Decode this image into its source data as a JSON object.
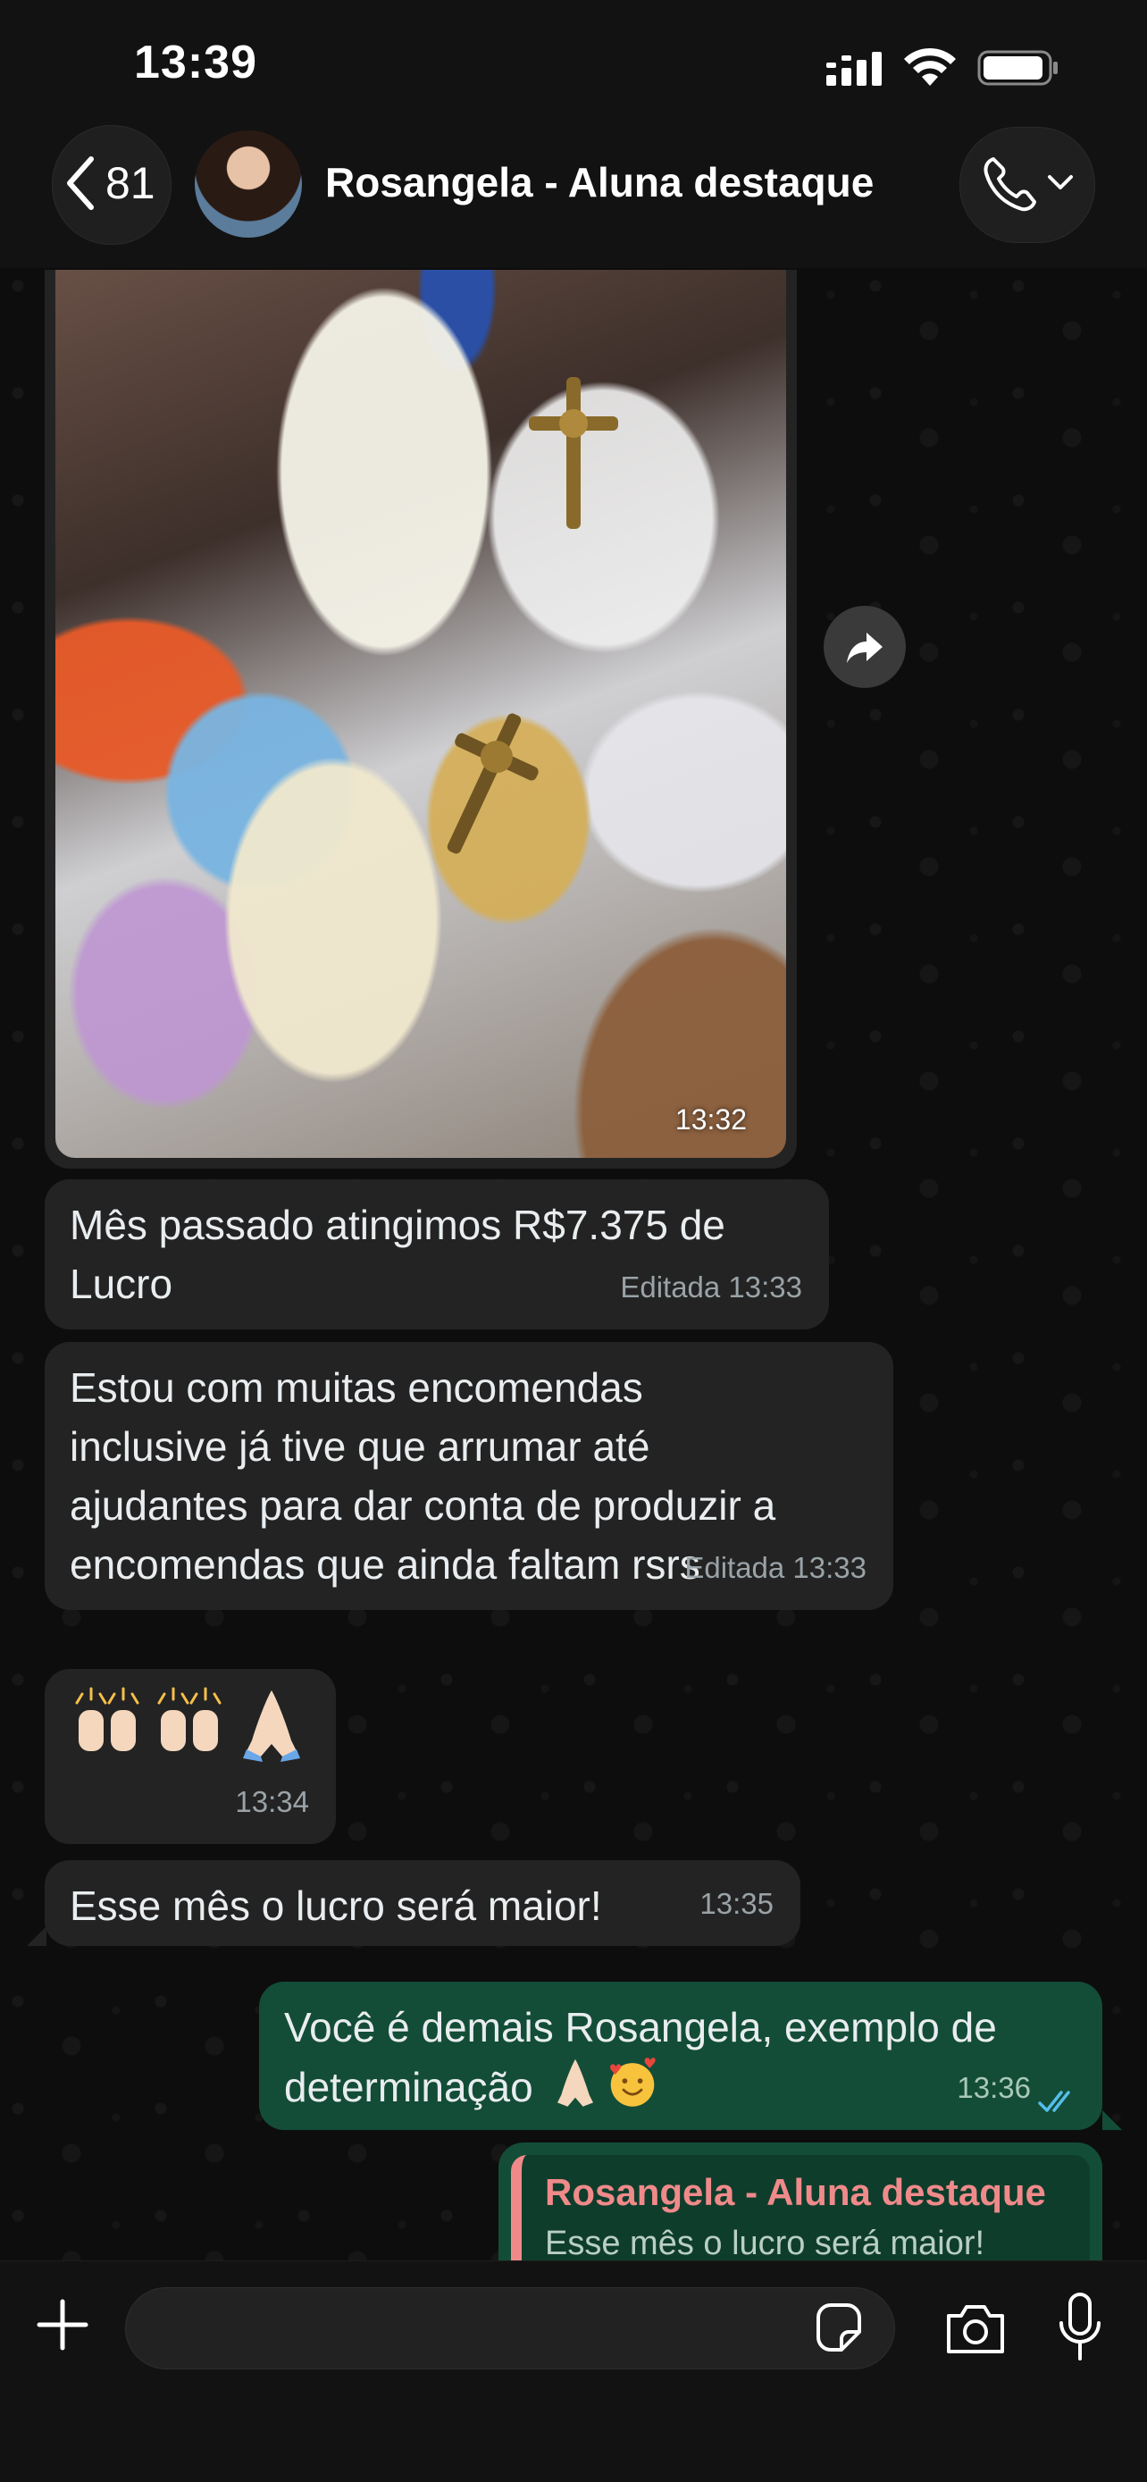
{
  "status_bar": {
    "time": "13:39"
  },
  "header": {
    "back_count": "81",
    "contact_name": "Rosangela - Aluna destaque"
  },
  "messages": [
    {
      "type": "image",
      "time": "13:32"
    },
    {
      "type": "text",
      "direction": "in",
      "lines": [
        "Mês passado atingimos R$7.375 de",
        "Lucro"
      ],
      "meta": "Editada 13:33"
    },
    {
      "type": "text",
      "direction": "in",
      "lines": [
        "Estou com muitas encomendas",
        "inclusive já tive que arrumar até",
        "ajudantes para dar conta de produzir a",
        "encomendas que ainda faltam rsrs"
      ],
      "meta": "Editada 13:33"
    },
    {
      "type": "emoji",
      "direction": "in",
      "emojis": [
        "raising-hands",
        "raising-hands",
        "folded-hands"
      ],
      "meta": "13:34"
    },
    {
      "type": "text",
      "direction": "in",
      "lines": [
        "Esse mês o lucro será maior!"
      ],
      "meta": "13:35"
    },
    {
      "type": "text",
      "direction": "out",
      "lines": [
        "Você é demais Rosangela, exemplo de",
        "determinação"
      ],
      "emojis": [
        "folded-hands",
        "smiling-face-with-hearts"
      ],
      "meta": "13:36",
      "status": "read"
    },
    {
      "type": "reply",
      "direction": "out",
      "quote_author": "Rosangela - Aluna destaque",
      "quote_text": "Esse mês o lucro será maior!"
    }
  ],
  "input": {
    "placeholder": "",
    "value": ""
  },
  "colors": {
    "incoming_bubble": "#232323",
    "outgoing_bubble": "#134d37",
    "quote_accent": "#f08a8a",
    "read_ticks": "#53bdeb"
  }
}
